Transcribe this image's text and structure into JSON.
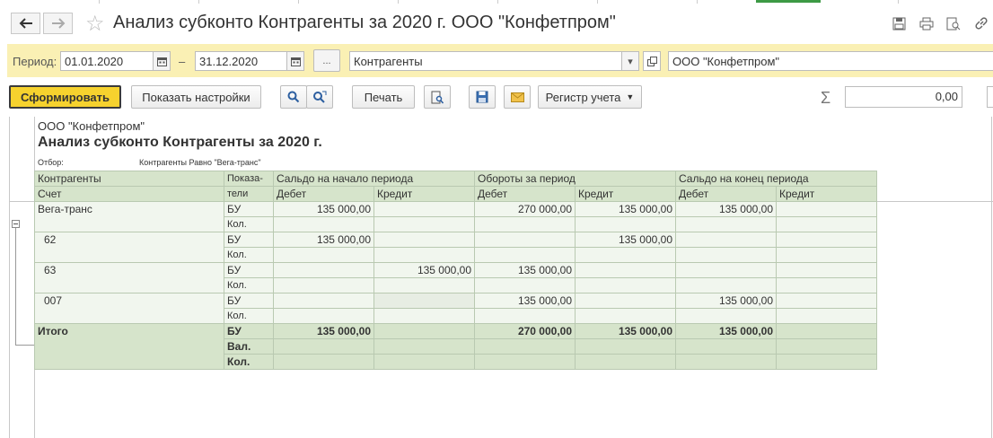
{
  "window": {
    "title": "Анализ субконто Контрагенты за 2020 г. ООО \"Конфетпром\""
  },
  "period": {
    "label": "Период:",
    "from": "01.01.2020",
    "dash": "–",
    "to": "31.12.2020",
    "more_btn": "...",
    "subconto": "Контрагенты",
    "org": "ООО \"Конфетпром\""
  },
  "toolbar": {
    "generate": "Сформировать",
    "show_settings": "Показать настройки",
    "print": "Печать",
    "register": "Регистр учета",
    "sum_symbol": "Σ",
    "sum_value": "0,00"
  },
  "report": {
    "org": "ООО \"Конфетпром\"",
    "title": "Анализ субконто Контрагенты за 2020 г.",
    "filter_label": "Отбор:",
    "filter_value": "Контрагенты Равно \"Вега-транс\"",
    "headers": {
      "counterparty": "Контрагенты",
      "account": "Счет",
      "indicator_top": "Показа-",
      "indicator_bottom": "тели",
      "opening": "Сальдо на начало периода",
      "turnover": "Обороты за период",
      "closing": "Сальдо на конец периода",
      "debit": "Дебет",
      "credit": "Кредит"
    },
    "rows": [
      {
        "name": "Вега-транс",
        "ind1": "БУ",
        "ind2": "Кол.",
        "od": "135 000,00",
        "oc": "",
        "td": "270 000,00",
        "tc": "135 000,00",
        "cd": "135 000,00",
        "cc": ""
      },
      {
        "name": "62",
        "ind1": "БУ",
        "ind2": "Кол.",
        "od": "135 000,00",
        "oc": "",
        "td": "",
        "tc": "135 000,00",
        "cd": "",
        "cc": ""
      },
      {
        "name": "63",
        "ind1": "БУ",
        "ind2": "Кол.",
        "od": "",
        "oc": "135 000,00",
        "td": "135 000,00",
        "tc": "",
        "cd": "",
        "cc": ""
      },
      {
        "name": "007",
        "ind1": "БУ",
        "ind2": "Кол.",
        "od": "",
        "oc": "",
        "td": "135 000,00",
        "tc": "",
        "cd": "135 000,00",
        "cc": ""
      }
    ],
    "total": {
      "name": "Итого",
      "ind1": "БУ",
      "ind2": "Вал.",
      "ind3": "Кол.",
      "od": "135 000,00",
      "oc": "",
      "td": "270 000,00",
      "tc": "135 000,00",
      "cd": "135 000,00",
      "cc": ""
    }
  }
}
